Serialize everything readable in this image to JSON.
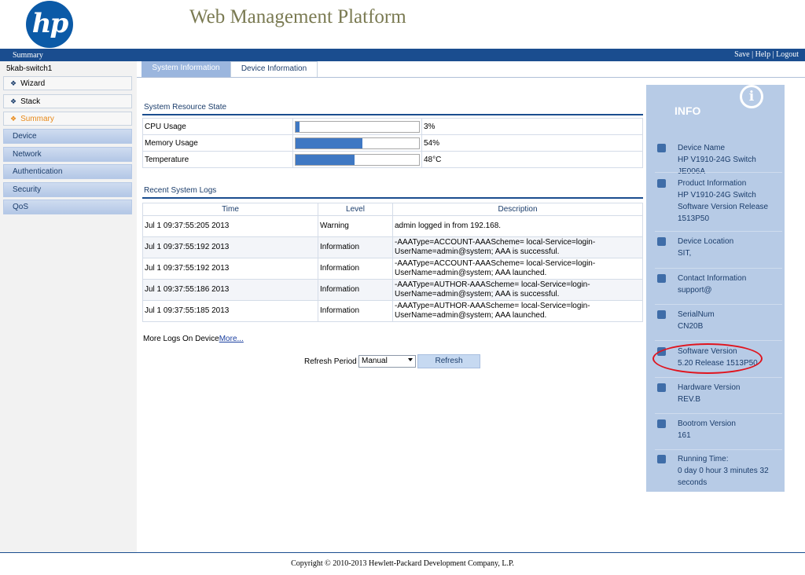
{
  "header": {
    "logo_text": "hp",
    "title": "Web Management Platform",
    "breadcrumb": "Summary",
    "links": [
      "Save",
      "Help",
      "Logout"
    ]
  },
  "sidebar": {
    "device": "5kab-switch1",
    "items": [
      {
        "label": "Wizard"
      },
      {
        "label": "Stack"
      },
      {
        "label": "Summary"
      }
    ],
    "groups": [
      "Device",
      "Network",
      "Authentication",
      "Security",
      "QoS"
    ]
  },
  "tabs": [
    "System Information",
    "Device Information"
  ],
  "resources": {
    "title": "System Resource State",
    "rows": [
      {
        "label": "CPU Usage",
        "percent": 3,
        "value": "3%"
      },
      {
        "label": "Memory Usage",
        "percent": 54,
        "value": "54%"
      },
      {
        "label": "Temperature",
        "percent": 48,
        "value": "48°C"
      }
    ]
  },
  "logs": {
    "title": "Recent System Logs",
    "headers": [
      "Time",
      "Level",
      "Description"
    ],
    "rows": [
      {
        "time": "Jul 1 09:37:55:205 2013",
        "level": "Warning",
        "desc": "admin logged in from 192.168."
      },
      {
        "time": "Jul 1 09:37:55:192 2013",
        "level": "Information",
        "desc": "-AAAType=ACCOUNT-AAAScheme= local-Service=login-UserName=admin@system; AAA is successful."
      },
      {
        "time": "Jul 1 09:37:55:192 2013",
        "level": "Information",
        "desc": "-AAAType=ACCOUNT-AAAScheme= local-Service=login-UserName=admin@system; AAA launched."
      },
      {
        "time": "Jul 1 09:37:55:186 2013",
        "level": "Information",
        "desc": "-AAAType=AUTHOR-AAAScheme= local-Service=login-UserName=admin@system; AAA is successful."
      },
      {
        "time": "Jul 1 09:37:55:185 2013",
        "level": "Information",
        "desc": "-AAAType=AUTHOR-AAAScheme= local-Service=login-UserName=admin@system; AAA launched."
      }
    ],
    "more_text": "More Logs On Device",
    "more_link": "More..."
  },
  "refresh": {
    "label": "Refresh Period",
    "selected": "Manual",
    "button": "Refresh"
  },
  "info": {
    "title": "INFO",
    "items": [
      {
        "label": "Device Name",
        "value": "HP V1910-24G Switch JE006A",
        "icon": "device-icon"
      },
      {
        "label": "Product Information",
        "value": "HP V1910-24G Switch Software Version Release 1513P50",
        "icon": "product-icon"
      },
      {
        "label": "Device Location",
        "value": "SIT,",
        "icon": "location-icon"
      },
      {
        "label": "Contact Information",
        "value": "support@",
        "icon": "contact-icon"
      },
      {
        "label": "SerialNum",
        "value": "CN20B",
        "icon": "serial-icon"
      },
      {
        "label": "Software Version",
        "value": "5.20 Release 1513P50",
        "icon": "software-icon"
      },
      {
        "label": "Hardware Version",
        "value": "REV.B",
        "icon": "hardware-icon"
      },
      {
        "label": "Bootrom Version",
        "value": "161",
        "icon": "bootrom-icon"
      },
      {
        "label": "Running Time:",
        "value": "0 day 0 hour 3 minutes 32 seconds",
        "icon": "clock-icon"
      }
    ]
  },
  "footer": "Copyright © 2010-2013 Hewlett-Packard Development Company, L.P."
}
